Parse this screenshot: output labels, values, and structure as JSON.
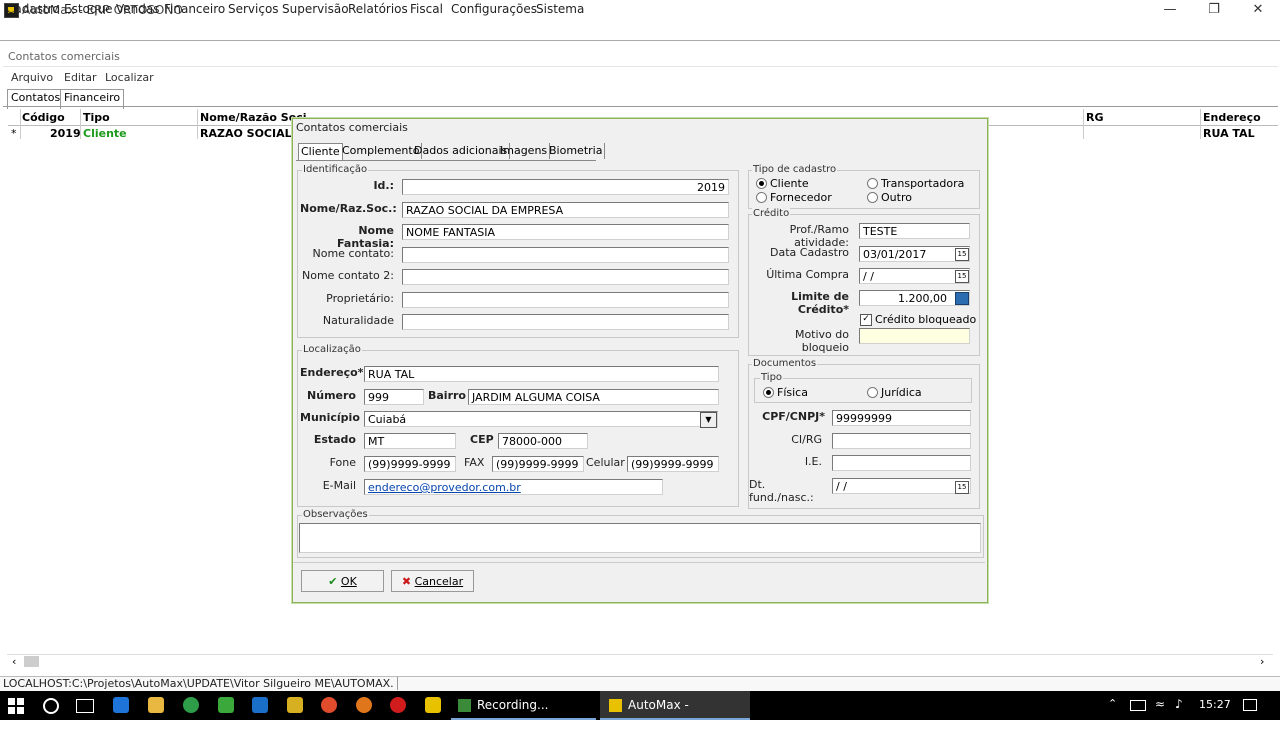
{
  "window": {
    "title": "AutoMax - ERP ORTOSONO"
  },
  "menubar": [
    "Cadastro",
    "Estoque",
    "Vendas",
    "Financeiro",
    "Serviços",
    "Supervisão",
    "Relatórios",
    "Fiscal",
    "Configurações",
    "Sistema"
  ],
  "mdi": {
    "title": "Contatos comerciais",
    "submenu": [
      "Arquivo",
      "Editar",
      "Localizar"
    ],
    "tabs": [
      "Contatos",
      "Financeiro"
    ],
    "grid": {
      "headers": [
        "Código",
        "Tipo",
        "Nome/Razão Soci",
        "RG",
        "Endereço"
      ],
      "row": {
        "marker": "*",
        "codigo": "2019",
        "tipo": "Cliente",
        "nome": "RAZAO SOCIAL DA",
        "endereco": "RUA TAL"
      }
    }
  },
  "dialog": {
    "title": "Contatos comerciais",
    "tabs": [
      "Cliente",
      "Complemento",
      "Dados adicionais",
      "Imagens",
      "Biometria"
    ],
    "identificacao": {
      "legend": "Identificação",
      "id_label": "Id.:",
      "id_value": "2019",
      "nome_label": "Nome/Raz.Soc.:",
      "nome_value": "RAZAO SOCIAL DA EMPRESA",
      "fantasia_label": "Nome Fantasia:",
      "fantasia_value": "NOME FANTASIA",
      "contato_label": "Nome contato:",
      "contato_value": "",
      "contato2_label": "Nome contato 2:",
      "contato2_value": "",
      "proprietario_label": "Proprietário:",
      "proprietario_value": "",
      "naturalidade_label": "Naturalidade",
      "naturalidade_value": ""
    },
    "tipo_cadastro": {
      "legend": "Tipo de cadastro",
      "options": [
        "Cliente",
        "Transportadora",
        "Fornecedor",
        "Outro"
      ],
      "selected": "Cliente"
    },
    "credito": {
      "legend": "Crédito",
      "prof_label": "Prof./Ramo atividade:",
      "prof_value": "TESTE",
      "data_label": "Data Cadastro",
      "data_value": "03/01/2017",
      "ultima_label": "Última Compra",
      "ultima_value": " / /",
      "limite_label": "Limite de Crédito*",
      "limite_value": "1.200,00",
      "bloqueado_label": "Crédito bloqueado",
      "bloqueado_checked": "✓",
      "motivo_label": "Motivo do bloqueio",
      "motivo_value": ""
    },
    "localizacao": {
      "legend": "Localização",
      "endereco_label": "Endereço*",
      "endereco_value": "RUA TAL",
      "numero_label": "Número",
      "numero_value": "999",
      "bairro_label": "Bairro",
      "bairro_value": "JARDIM ALGUMA COISA",
      "municipio_label": "Município",
      "municipio_value": "Cuiabá",
      "estado_label": "Estado",
      "estado_value": "MT",
      "cep_label": "CEP",
      "cep_value": "78000-000",
      "fone_label": "Fone",
      "fone_value": "(99)9999-9999",
      "fax_label": "FAX",
      "fax_value": "(99)9999-9999",
      "celular_label": "Celular",
      "celular_value": "(99)9999-9999",
      "email_label": "E-Mail",
      "email_value": "endereco@provedor.com.br"
    },
    "documentos": {
      "legend": "Documentos",
      "tipo_legend": "Tipo",
      "tipo_options": [
        "Física",
        "Jurídica"
      ],
      "tipo_selected": "Física",
      "cpf_label": "CPF/CNPJ*",
      "cpf_value": "99999999",
      "rg_label": "CI/RG",
      "rg_value": "",
      "ie_label": "I.E.",
      "ie_value": "",
      "dtfund_label": "Dt. fund./nasc.:",
      "dtfund_value": " / /"
    },
    "observacoes": {
      "legend": "Observações",
      "value": ""
    },
    "ok_label": "OK",
    "cancel_label": "Cancelar"
  },
  "statusbar": {
    "path": "LOCALHOST:C:\\Projetos\\AutoMax\\UPDATE\\Vitor Silgueiro ME\\AUTOMAX."
  },
  "taskbar": {
    "recording_label": "Recording...",
    "automax_label": "AutoMax - Retaguarda",
    "time": "15:27"
  }
}
